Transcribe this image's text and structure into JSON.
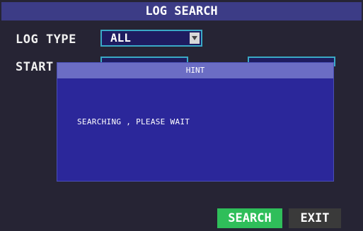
{
  "window": {
    "title": "LOG SEARCH"
  },
  "form": {
    "log_type_label": "LOG TYPE",
    "log_type_value": "ALL",
    "start_label": "START"
  },
  "dialog": {
    "title": "HINT",
    "message": "SEARCHING , PLEASE WAIT"
  },
  "buttons": {
    "search_label": "SEARCH",
    "exit_label": "EXIT"
  },
  "colors": {
    "background": "#262434",
    "title_bar": "#3c3c86",
    "field_border": "#3aa9c6",
    "dialog_body": "#2b279a",
    "dialog_header": "#6b6dc4",
    "search_button": "#2fbe5a",
    "exit_button": "#3a3a3a"
  },
  "icons": {
    "dropdown": "chevron-down-icon"
  }
}
